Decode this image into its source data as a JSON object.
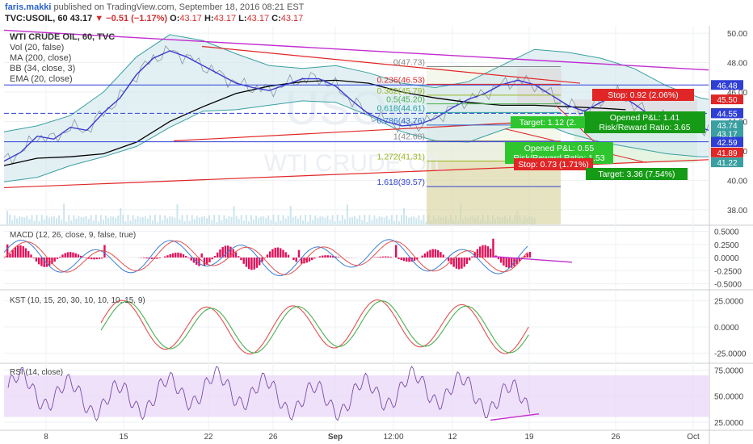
{
  "header": {
    "author": "faris.makki",
    "published": "published on TradingView.com, September 18, 2016 08:21 EST",
    "symbol": "TVC:USOIL, 60",
    "last": "43.17",
    "change_arrow": "▼",
    "change": "−0.51 (−1.17%)",
    "o_label": "O:",
    "o": "43.17",
    "h_label": "H:",
    "h": "43.17",
    "l_label": "L:",
    "l": "43.17",
    "c_label": "C:",
    "c": "43.17"
  },
  "legend": {
    "title": "WTI CRUDE OIL, 60, TVC",
    "items": [
      "Vol (20, false)",
      "MA (200, close)",
      "BB (34, close, 3)",
      "EMA (20, close)"
    ]
  },
  "watermark": {
    "symbol": "USOIL",
    "name": "WTI CRUDE OIL"
  },
  "colors": {
    "ma": "#000000",
    "ema": "#3b3bd1",
    "bb": "#3a9fa0",
    "bb_fill": "#cfe6ec",
    "trend_red": "#e02626",
    "trend_purple": "#c12ccf",
    "hline_blue": "#2f3fd6",
    "macd_hist": "#e0105a",
    "signal_red": "#e25050",
    "signal_green": "#4caf50",
    "kst_red": "#e25050",
    "kst_green": "#4caf50",
    "rsi": "#7a4aa8",
    "rsi_band": "#e8d4f6"
  },
  "chart_data": [
    {
      "type": "line",
      "name": "price",
      "ylim": [
        37.0,
        50.5
      ],
      "y_ticks": [
        "50.00",
        "48.00",
        "46.00",
        "44.00",
        "42.00",
        "40.00",
        "38.00"
      ],
      "x_ticks": [
        "8",
        "15",
        "22",
        "26",
        "Sep",
        "12:00",
        "12",
        "19",
        "26",
        "Oct"
      ],
      "price_labels": [
        {
          "text": "46.48",
          "value": 46.48,
          "color": "#2f3fd6"
        },
        {
          "text": "45.50",
          "value": 45.5,
          "color": "#e02626"
        },
        {
          "text": "44.58",
          "value": 44.58,
          "color": "#555555"
        },
        {
          "text": "44.55",
          "value": 44.55,
          "color": "#2f3fd6"
        },
        {
          "text": "43.74",
          "value": 43.74,
          "color": "#3a9fa0"
        },
        {
          "text": "43.17",
          "value": 43.17,
          "color": "#3a9fa0"
        },
        {
          "text": "42.62",
          "value": 42.62,
          "color": "#2f3fd6"
        },
        {
          "text": "42.59",
          "value": 42.59,
          "color": "#2f3fd6"
        },
        {
          "text": "41.89",
          "value": 41.89,
          "color": "#e02626"
        },
        {
          "text": "41.22",
          "value": 41.22,
          "color": "#3a9fa0"
        }
      ],
      "fib_levels": [
        {
          "label": "0(47.73)",
          "value": 47.73,
          "color": "#888888"
        },
        {
          "label": "0.236(46.53)",
          "value": 46.53,
          "color": "#e02626"
        },
        {
          "label": "0.382(45.79)",
          "value": 45.79,
          "color": "#9bb520"
        },
        {
          "label": "0.5(45.20)",
          "value": 45.2,
          "color": "#4caf50"
        },
        {
          "label": "0.618(44.61)",
          "value": 44.61,
          "color": "#26a0a0"
        },
        {
          "label": "0.786(43.76)",
          "value": 43.76,
          "color": "#2f6fd6"
        },
        {
          "label": "1(42.68)",
          "value": 42.68,
          "color": "#888888"
        },
        {
          "label": "1.272(41.31)",
          "value": 41.31,
          "color": "#9bb520"
        },
        {
          "label": "1.618(39.57)",
          "value": 39.57,
          "color": "#2f3fd6"
        }
      ],
      "annotations": [
        {
          "text": "Stop: 0.92 (2.06%)",
          "kind": "stop"
        },
        {
          "text": "Opened P&L: 1.41",
          "kind": "pnl"
        },
        {
          "text": "Risk/Reward Ratio: 3.65",
          "kind": "pnl"
        },
        {
          "text": "Target: 1.12 (2.",
          "kind": "target"
        },
        {
          "text": "Opened P&L: 0.55",
          "kind": "pnl"
        },
        {
          "text": "Risk/Reward Ratio: 1.53",
          "kind": "pnl"
        },
        {
          "text": "Stop: 0.73 (1.71%)",
          "kind": "stop"
        },
        {
          "text": "Target: 3.36 (7.54%)",
          "kind": "target"
        }
      ],
      "series": [
        {
          "name": "EMA",
          "x": [
            0,
            4,
            8,
            12,
            16,
            20,
            24,
            28,
            32,
            36,
            40,
            44,
            48,
            52,
            56,
            60,
            64,
            68,
            72,
            76,
            80,
            84,
            88,
            92,
            96,
            100,
            104,
            108,
            112,
            116,
            120,
            124,
            128,
            132,
            136,
            140,
            144,
            148,
            152,
            156,
            160,
            164,
            168,
            170
          ],
          "values": [
            41.3,
            41.9,
            43.0,
            42.8,
            43.6,
            43.4,
            44.6,
            45.6,
            47.2,
            48.3,
            48.8,
            48.4,
            47.8,
            47.2,
            46.6,
            46.3,
            46.1,
            46.5,
            46.9,
            46.9,
            46.4,
            45.4,
            44.5,
            44.0,
            43.7,
            43.8,
            44.2,
            44.9,
            45.5,
            45.9,
            46.5,
            46.8,
            46.5,
            45.8,
            45.1,
            44.7,
            45.3,
            45.9,
            45.2,
            44.4,
            44.3,
            43.9,
            43.6,
            43.4
          ]
        },
        {
          "name": "MA",
          "x": [
            0,
            8,
            16,
            24,
            32,
            40,
            48,
            56,
            64,
            72,
            80,
            88,
            96,
            104,
            112,
            120,
            128,
            136,
            144,
            150
          ],
          "values": [
            41.0,
            41.5,
            41.6,
            41.8,
            42.6,
            44.0,
            45.0,
            45.9,
            46.4,
            46.7,
            46.8,
            46.6,
            46.0,
            45.6,
            45.3,
            45.1,
            45.1,
            45.0,
            44.9,
            44.8
          ]
        },
        {
          "name": "BB upper",
          "x": [
            0,
            8,
            16,
            24,
            32,
            40,
            48,
            56,
            64,
            72,
            80,
            88,
            96,
            104,
            112,
            120,
            128,
            136,
            144,
            152,
            160,
            168,
            170
          ],
          "values": [
            43.3,
            43.7,
            44.4,
            46.0,
            48.4,
            49.9,
            49.5,
            48.6,
            47.8,
            47.6,
            47.8,
            47.3,
            46.6,
            46.3,
            46.7,
            47.8,
            48.9,
            48.7,
            48.3,
            47.6,
            46.4,
            45.6,
            45.5
          ]
        },
        {
          "name": "BB lower",
          "x": [
            0,
            8,
            16,
            24,
            32,
            40,
            48,
            56,
            64,
            72,
            80,
            88,
            96,
            104,
            112,
            120,
            128,
            136,
            144,
            152,
            160,
            168,
            170
          ],
          "values": [
            39.9,
            40.2,
            41.0,
            41.6,
            42.3,
            43.6,
            44.7,
            44.8,
            45.1,
            45.4,
            45.3,
            44.4,
            43.3,
            42.7,
            42.6,
            43.4,
            44.1,
            43.2,
            42.6,
            42.2,
            41.8,
            41.6,
            41.6
          ]
        }
      ]
    },
    {
      "type": "line",
      "name": "MACD (12, 26, close, 9, false, true)",
      "ylim": [
        -0.6,
        0.6
      ],
      "y_ticks": [
        "0.5000",
        "0.2500",
        "0.0000",
        "-0.2500",
        "-0.5000"
      ]
    },
    {
      "type": "line",
      "name": "KST (10, 15, 20, 30, 10, 10, 10, 15, 9)",
      "ylim": [
        -34,
        34
      ],
      "y_ticks": [
        "25.0000",
        "0.0000",
        "-25.0000"
      ]
    },
    {
      "type": "line",
      "name": "RSI (14, close)",
      "ylim": [
        18,
        80
      ],
      "y_ticks": [
        "75.0000",
        "50.0000",
        "25.0000"
      ],
      "band": [
        30,
        70
      ]
    }
  ]
}
